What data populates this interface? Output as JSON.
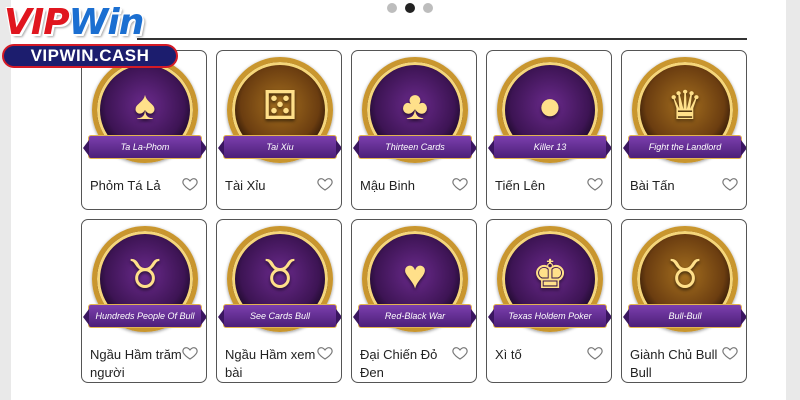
{
  "logo": {
    "title_vip": "VIP",
    "title_win": "Win",
    "domain": "VIPWIN.CASH"
  },
  "carousel": {
    "dots": 3,
    "active_index": 1
  },
  "colors": {
    "ribbon": "#5a2a8a",
    "frame_gold": "#c9962e",
    "logo_red": "#e0161f",
    "logo_blue": "#1b6fd1",
    "logo_navy": "#1c1d6e"
  },
  "games": [
    {
      "ribbon": "Ta La-Phom",
      "name": "Phỏm Tá Lả",
      "icon": "cards-icon",
      "glyph": "♠"
    },
    {
      "ribbon": "Tai Xiu",
      "name": "Tài Xỉu",
      "icon": "dice-icon",
      "glyph": "⚄"
    },
    {
      "ribbon": "Thirteen Cards",
      "name": "Mậu Binh",
      "icon": "revolver-icon",
      "glyph": "♣"
    },
    {
      "ribbon": "Killer 13",
      "name": "Tiến Lên",
      "icon": "bomb-icon",
      "glyph": "●"
    },
    {
      "ribbon": "Fight the Landlord",
      "name": "Bài Tấn",
      "icon": "landlord-icon",
      "glyph": "♛"
    },
    {
      "ribbon": "Hundreds People Of Bull",
      "name": "Ngầu Hầm trăm người",
      "icon": "bull-icon",
      "glyph": "♉"
    },
    {
      "ribbon": "See Cards Bull",
      "name": "Ngầu Hầm xem bài",
      "icon": "bull-mascot-icon",
      "glyph": "♉"
    },
    {
      "ribbon": "Red-Black War",
      "name": "Đại Chiến Đỏ Đen",
      "icon": "versus-icon",
      "glyph": "♥"
    },
    {
      "ribbon": "Texas Holdem Poker",
      "name": "Xì tố",
      "icon": "crown-icon",
      "glyph": "♚"
    },
    {
      "ribbon": "Bull-Bull",
      "name": "Giành Chủ Bull Bull",
      "icon": "golden-bull-icon",
      "glyph": "♉"
    }
  ]
}
